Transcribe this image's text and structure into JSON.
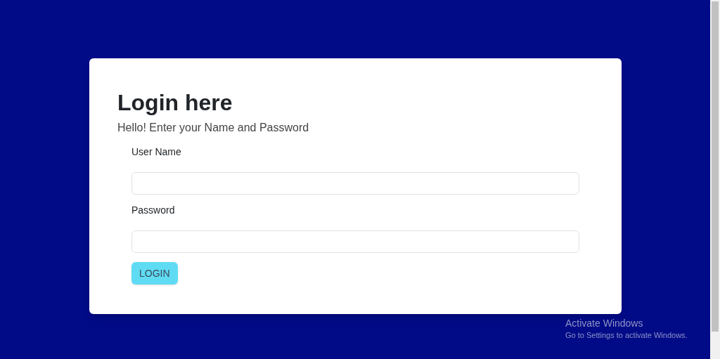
{
  "card": {
    "title": "Login here",
    "subtitle": "Hello! Enter your Name and Password",
    "fields": [
      {
        "label": "User Name"
      },
      {
        "label": "Password"
      }
    ],
    "button": "LOGIN"
  },
  "os_notice": {
    "title": "Activate Windows",
    "text": "Go to Settings to activate Windows."
  }
}
